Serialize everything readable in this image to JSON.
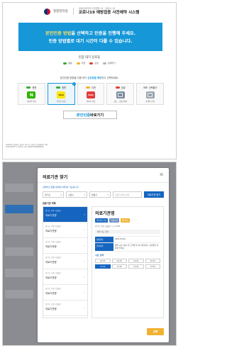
{
  "header": {
    "agency": "질병관리청",
    "subtitle": "코로나바이러스감염증-19 · 코로나-19",
    "title": "코로나19 예방접종 사전예약 시스템"
  },
  "banner": {
    "line1_highlight": "본인인증 방법",
    "line1_rest": "을 선택하고 인증을 진행해 주세요.",
    "line2": "인증 방법별로 대기 시간이 다를 수 있습니다."
  },
  "wait_status": {
    "title": "인증 대기 신호등",
    "legend": [
      {
        "label": "원활",
        "color": "#39a935"
      },
      {
        "label": "지연",
        "color": "#f1b233"
      },
      {
        "label": "혼잡",
        "color": "#e0432f"
      },
      {
        "label": "선택불가",
        "color": "#b5b5b5"
      }
    ]
  },
  "guide": {
    "prefix": "본인인증 방법별 인증 대기 ",
    "highlight": "신호등을 확인",
    "suffix": "하고 선택하세요."
  },
  "methods": [
    {
      "status": "원활",
      "color": "#39a935",
      "label": "네이버 인증",
      "icon": "naver-icon",
      "tile": "#2db400",
      "glyph": "N",
      "selected": false
    },
    {
      "status": "원활",
      "color": "#39a935",
      "label": "카카오 인증",
      "icon": "kakao-talk-icon",
      "tile": "#fee500",
      "glyph": "TALK",
      "selected": true,
      "check": "✓"
    },
    {
      "status": "지연",
      "color": "#f1b233",
      "label": "PASS 인증",
      "icon": "pass-icon",
      "tile": "#e23d3d",
      "glyph": "PASS",
      "selected": false
    },
    {
      "status": "혼잡",
      "color": "#e0432f",
      "label": "공동 · 금융인증서",
      "icon": "certificate-icon",
      "tile": "#7c8a9e",
      "glyph": "",
      "selected": false
    },
    {
      "status": "선택불가",
      "color": "#b5b5b5",
      "label": "휴대폰 인증",
      "icon": "phone-icon",
      "tile": "#9aa3ad",
      "glyph": "",
      "selected": false
    }
  ],
  "bypass": {
    "highlight": "본인인증",
    "rest": " 바로가기"
  },
  "footer": {
    "line1": "(28159) 충청북도 청주시 흥덕구 오송읍 오송생명2로 187",
    "line2": "COPYRIGHT © KDCA. ALL RIGHTS RESERVED."
  },
  "modal": {
    "title": "의료기관 찾기",
    "close": "✕",
    "hint": "선택하신 접종기관에서 예약이 가능합니다.",
    "filters": {
      "region1": "경기도",
      "region2": "수원시",
      "region3": "팔달구",
      "placeholder": "의료기관명 입력",
      "search_label": "의료기관 찾기"
    },
    "list_title": "접종기관 목록",
    "list": [
      {
        "sub": "경기도 수원시 팔달구",
        "name": "의료기관명",
        "active": true
      },
      {
        "sub": "경기도 수원시 팔달구",
        "name": "의료기관명",
        "active": false
      },
      {
        "sub": "경기도 수원시 팔달구",
        "name": "의료기관명",
        "active": false
      },
      {
        "sub": "경기도 수원시 팔달구",
        "name": "의료기관명",
        "active": false
      },
      {
        "sub": "경기도 수원시 팔달구",
        "name": "의료기관명",
        "active": false
      },
      {
        "sub": "경기도 수원시 팔달구",
        "name": "의료기관명",
        "active": false
      },
      {
        "sub": "경기도 수원시 팔달구",
        "name": "의료기관명",
        "active": false
      }
    ],
    "detail": {
      "name": "의료기관명",
      "tags": [
        "위탁의료기관",
        "지정기관",
        "예약가능"
      ],
      "address": "경기도 수원시 팔달구 ○○로 000",
      "bar": "예약 가능 일자",
      "rows": [
        {
          "k": "접종일자",
          "v": "2021.00.00"
        },
        {
          "k": "안내사항",
          "v": "예약 시간 30분 전 도착해 주시기 바랍니다. 신분증을 지참해 주세요."
        }
      ],
      "section": "시간 선택",
      "times": [
        "09:00",
        "09:30",
        "10:00",
        "10:30",
        "11:00",
        "11:30",
        "13:00",
        "13:30"
      ],
      "active_time": 4
    },
    "ok_label": "선택"
  }
}
